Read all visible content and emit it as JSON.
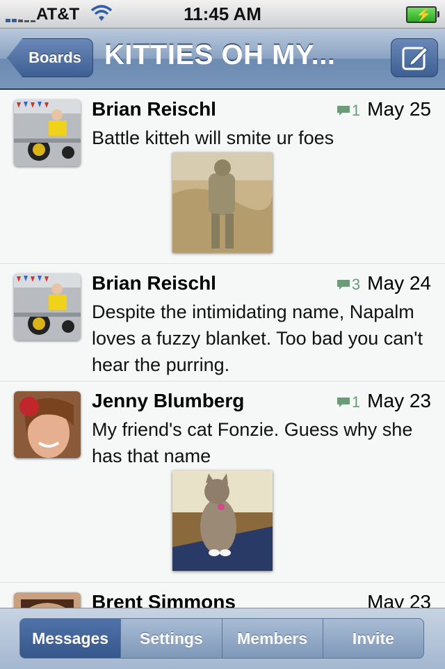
{
  "status_bar": {
    "carrier": "AT&T",
    "time": "11:45 AM"
  },
  "nav": {
    "back_label": "Boards",
    "title": "KITTIES OH MY..."
  },
  "messages": [
    {
      "author": "Brian Reischl",
      "comments": "1",
      "date": "May 25",
      "text": "Battle kitteh will smite ur foes"
    },
    {
      "author": "Brian Reischl",
      "comments": "3",
      "date": "May 24",
      "text": "Despite the intimidating name, Napalm loves a fuzzy blanket. Too bad you can't hear the purring."
    },
    {
      "author": "Jenny Blumberg",
      "comments": "1",
      "date": "May 23",
      "text": "My friend's cat Fonzie. Guess why she has that name"
    },
    {
      "author": "Brent Simmons",
      "comments": "",
      "date": "May 23",
      "text": ""
    }
  ],
  "tabs": [
    "Messages",
    "Settings",
    "Members",
    "Invite"
  ],
  "colors": {
    "nav_blue": "#7895bb",
    "comment_green": "#6a9c78",
    "active_tab": "#36578b"
  }
}
